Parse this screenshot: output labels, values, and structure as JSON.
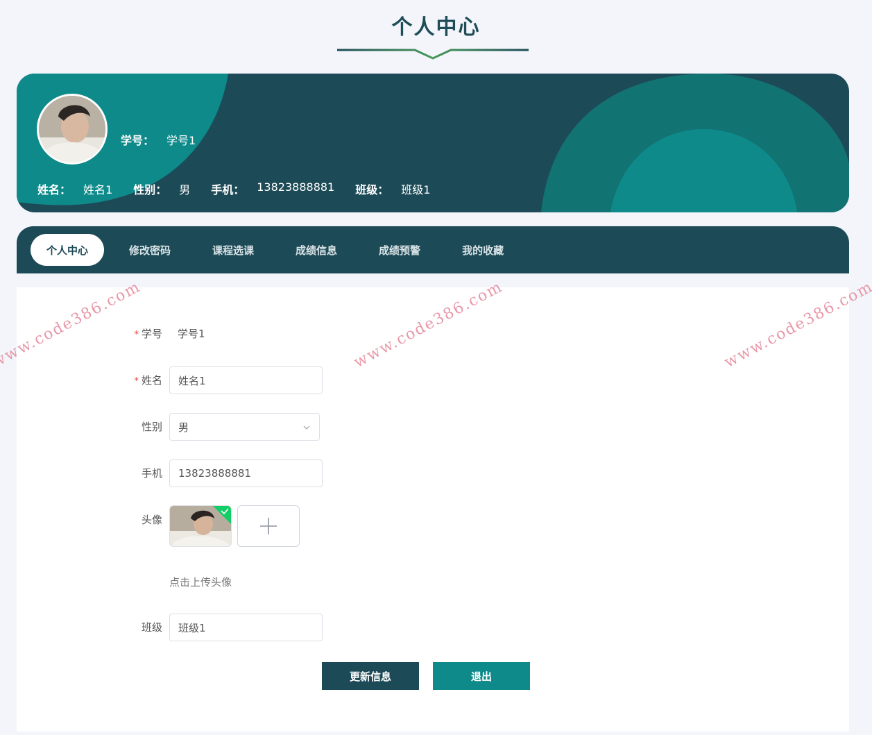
{
  "page": {
    "title": "个人中心"
  },
  "profile": {
    "student_id_label": "学号：",
    "student_id": "学号1",
    "name_label": "姓名：",
    "name": "姓名1",
    "gender_label": "性别：",
    "gender": "男",
    "phone_label": "手机：",
    "phone": "13823888881",
    "class_label": "班级：",
    "class_name": "班级1"
  },
  "tabs": [
    {
      "label": "个人中心",
      "active": true
    },
    {
      "label": "修改密码"
    },
    {
      "label": "课程选课"
    },
    {
      "label": "成绩信息"
    },
    {
      "label": "成绩预警"
    },
    {
      "label": "我的收藏"
    }
  ],
  "form": {
    "student_id": {
      "label": "学号",
      "value": "学号1",
      "required": true
    },
    "name": {
      "label": "姓名",
      "value": "姓名1",
      "required": true
    },
    "gender": {
      "label": "性别",
      "value": "男"
    },
    "phone": {
      "label": "手机",
      "value": "13823888881"
    },
    "avatar": {
      "label": "头像",
      "hint": "点击上传头像"
    },
    "class_name": {
      "label": "班级",
      "value": "班级1"
    },
    "required_mark": "*"
  },
  "buttons": {
    "update": "更新信息",
    "exit": "退出"
  },
  "watermark": "www.code386.com",
  "colors": {
    "primary": "#1d4a57",
    "teal": "#0e8a8a",
    "accent_green": "#4a9a5a"
  }
}
